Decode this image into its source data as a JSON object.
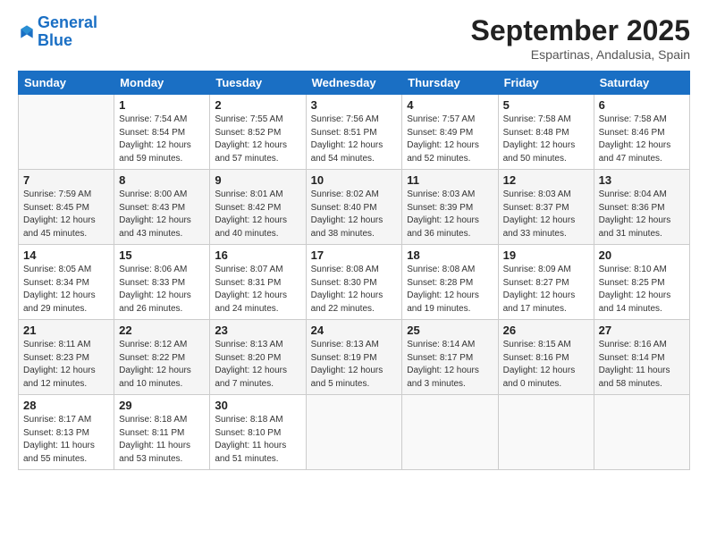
{
  "logo": {
    "line1": "General",
    "line2": "Blue"
  },
  "title": "September 2025",
  "subtitle": "Espartinas, Andalusia, Spain",
  "weekdays": [
    "Sunday",
    "Monday",
    "Tuesday",
    "Wednesday",
    "Thursday",
    "Friday",
    "Saturday"
  ],
  "weeks": [
    [
      {
        "day": "",
        "info": ""
      },
      {
        "day": "1",
        "info": "Sunrise: 7:54 AM\nSunset: 8:54 PM\nDaylight: 12 hours\nand 59 minutes."
      },
      {
        "day": "2",
        "info": "Sunrise: 7:55 AM\nSunset: 8:52 PM\nDaylight: 12 hours\nand 57 minutes."
      },
      {
        "day": "3",
        "info": "Sunrise: 7:56 AM\nSunset: 8:51 PM\nDaylight: 12 hours\nand 54 minutes."
      },
      {
        "day": "4",
        "info": "Sunrise: 7:57 AM\nSunset: 8:49 PM\nDaylight: 12 hours\nand 52 minutes."
      },
      {
        "day": "5",
        "info": "Sunrise: 7:58 AM\nSunset: 8:48 PM\nDaylight: 12 hours\nand 50 minutes."
      },
      {
        "day": "6",
        "info": "Sunrise: 7:58 AM\nSunset: 8:46 PM\nDaylight: 12 hours\nand 47 minutes."
      }
    ],
    [
      {
        "day": "7",
        "info": "Sunrise: 7:59 AM\nSunset: 8:45 PM\nDaylight: 12 hours\nand 45 minutes."
      },
      {
        "day": "8",
        "info": "Sunrise: 8:00 AM\nSunset: 8:43 PM\nDaylight: 12 hours\nand 43 minutes."
      },
      {
        "day": "9",
        "info": "Sunrise: 8:01 AM\nSunset: 8:42 PM\nDaylight: 12 hours\nand 40 minutes."
      },
      {
        "day": "10",
        "info": "Sunrise: 8:02 AM\nSunset: 8:40 PM\nDaylight: 12 hours\nand 38 minutes."
      },
      {
        "day": "11",
        "info": "Sunrise: 8:03 AM\nSunset: 8:39 PM\nDaylight: 12 hours\nand 36 minutes."
      },
      {
        "day": "12",
        "info": "Sunrise: 8:03 AM\nSunset: 8:37 PM\nDaylight: 12 hours\nand 33 minutes."
      },
      {
        "day": "13",
        "info": "Sunrise: 8:04 AM\nSunset: 8:36 PM\nDaylight: 12 hours\nand 31 minutes."
      }
    ],
    [
      {
        "day": "14",
        "info": "Sunrise: 8:05 AM\nSunset: 8:34 PM\nDaylight: 12 hours\nand 29 minutes."
      },
      {
        "day": "15",
        "info": "Sunrise: 8:06 AM\nSunset: 8:33 PM\nDaylight: 12 hours\nand 26 minutes."
      },
      {
        "day": "16",
        "info": "Sunrise: 8:07 AM\nSunset: 8:31 PM\nDaylight: 12 hours\nand 24 minutes."
      },
      {
        "day": "17",
        "info": "Sunrise: 8:08 AM\nSunset: 8:30 PM\nDaylight: 12 hours\nand 22 minutes."
      },
      {
        "day": "18",
        "info": "Sunrise: 8:08 AM\nSunset: 8:28 PM\nDaylight: 12 hours\nand 19 minutes."
      },
      {
        "day": "19",
        "info": "Sunrise: 8:09 AM\nSunset: 8:27 PM\nDaylight: 12 hours\nand 17 minutes."
      },
      {
        "day": "20",
        "info": "Sunrise: 8:10 AM\nSunset: 8:25 PM\nDaylight: 12 hours\nand 14 minutes."
      }
    ],
    [
      {
        "day": "21",
        "info": "Sunrise: 8:11 AM\nSunset: 8:23 PM\nDaylight: 12 hours\nand 12 minutes."
      },
      {
        "day": "22",
        "info": "Sunrise: 8:12 AM\nSunset: 8:22 PM\nDaylight: 12 hours\nand 10 minutes."
      },
      {
        "day": "23",
        "info": "Sunrise: 8:13 AM\nSunset: 8:20 PM\nDaylight: 12 hours\nand 7 minutes."
      },
      {
        "day": "24",
        "info": "Sunrise: 8:13 AM\nSunset: 8:19 PM\nDaylight: 12 hours\nand 5 minutes."
      },
      {
        "day": "25",
        "info": "Sunrise: 8:14 AM\nSunset: 8:17 PM\nDaylight: 12 hours\nand 3 minutes."
      },
      {
        "day": "26",
        "info": "Sunrise: 8:15 AM\nSunset: 8:16 PM\nDaylight: 12 hours\nand 0 minutes."
      },
      {
        "day": "27",
        "info": "Sunrise: 8:16 AM\nSunset: 8:14 PM\nDaylight: 11 hours\nand 58 minutes."
      }
    ],
    [
      {
        "day": "28",
        "info": "Sunrise: 8:17 AM\nSunset: 8:13 PM\nDaylight: 11 hours\nand 55 minutes."
      },
      {
        "day": "29",
        "info": "Sunrise: 8:18 AM\nSunset: 8:11 PM\nDaylight: 11 hours\nand 53 minutes."
      },
      {
        "day": "30",
        "info": "Sunrise: 8:18 AM\nSunset: 8:10 PM\nDaylight: 11 hours\nand 51 minutes."
      },
      {
        "day": "",
        "info": ""
      },
      {
        "day": "",
        "info": ""
      },
      {
        "day": "",
        "info": ""
      },
      {
        "day": "",
        "info": ""
      }
    ]
  ]
}
